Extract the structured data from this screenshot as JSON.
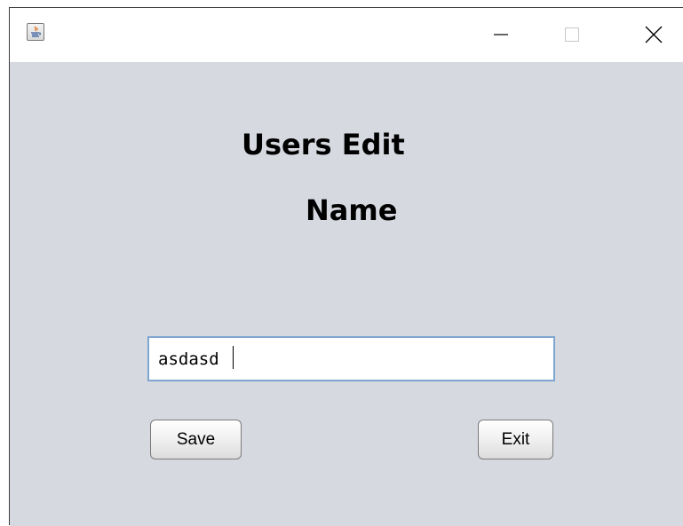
{
  "window": {
    "controls": {
      "minimize_icon": "minimize-icon",
      "maximize_icon": "maximize-icon",
      "close_icon": "close-icon"
    },
    "app_icon": "java-icon"
  },
  "form": {
    "title": "Users Edit",
    "field_label": "Name",
    "name_value": "asdasd",
    "save_label": "Save",
    "exit_label": "Exit"
  },
  "colors": {
    "content_background": "#d6d9e0",
    "input_border": "#7ea6cf",
    "titlebar_background": "#ffffff"
  }
}
